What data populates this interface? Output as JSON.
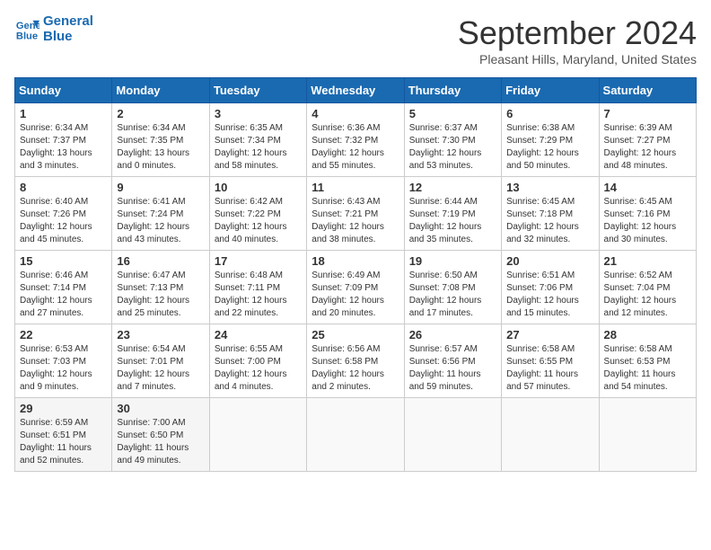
{
  "logo": {
    "line1": "General",
    "line2": "Blue"
  },
  "title": "September 2024",
  "subtitle": "Pleasant Hills, Maryland, United States",
  "days_of_week": [
    "Sunday",
    "Monday",
    "Tuesday",
    "Wednesday",
    "Thursday",
    "Friday",
    "Saturday"
  ],
  "weeks": [
    [
      {
        "day": "1",
        "sunrise": "6:34 AM",
        "sunset": "7:37 PM",
        "daylight": "13 hours and 3 minutes."
      },
      {
        "day": "2",
        "sunrise": "6:34 AM",
        "sunset": "7:35 PM",
        "daylight": "13 hours and 0 minutes."
      },
      {
        "day": "3",
        "sunrise": "6:35 AM",
        "sunset": "7:34 PM",
        "daylight": "12 hours and 58 minutes."
      },
      {
        "day": "4",
        "sunrise": "6:36 AM",
        "sunset": "7:32 PM",
        "daylight": "12 hours and 55 minutes."
      },
      {
        "day": "5",
        "sunrise": "6:37 AM",
        "sunset": "7:30 PM",
        "daylight": "12 hours and 53 minutes."
      },
      {
        "day": "6",
        "sunrise": "6:38 AM",
        "sunset": "7:29 PM",
        "daylight": "12 hours and 50 minutes."
      },
      {
        "day": "7",
        "sunrise": "6:39 AM",
        "sunset": "7:27 PM",
        "daylight": "12 hours and 48 minutes."
      }
    ],
    [
      {
        "day": "8",
        "sunrise": "6:40 AM",
        "sunset": "7:26 PM",
        "daylight": "12 hours and 45 minutes."
      },
      {
        "day": "9",
        "sunrise": "6:41 AM",
        "sunset": "7:24 PM",
        "daylight": "12 hours and 43 minutes."
      },
      {
        "day": "10",
        "sunrise": "6:42 AM",
        "sunset": "7:22 PM",
        "daylight": "12 hours and 40 minutes."
      },
      {
        "day": "11",
        "sunrise": "6:43 AM",
        "sunset": "7:21 PM",
        "daylight": "12 hours and 38 minutes."
      },
      {
        "day": "12",
        "sunrise": "6:44 AM",
        "sunset": "7:19 PM",
        "daylight": "12 hours and 35 minutes."
      },
      {
        "day": "13",
        "sunrise": "6:45 AM",
        "sunset": "7:18 PM",
        "daylight": "12 hours and 32 minutes."
      },
      {
        "day": "14",
        "sunrise": "6:45 AM",
        "sunset": "7:16 PM",
        "daylight": "12 hours and 30 minutes."
      }
    ],
    [
      {
        "day": "15",
        "sunrise": "6:46 AM",
        "sunset": "7:14 PM",
        "daylight": "12 hours and 27 minutes."
      },
      {
        "day": "16",
        "sunrise": "6:47 AM",
        "sunset": "7:13 PM",
        "daylight": "12 hours and 25 minutes."
      },
      {
        "day": "17",
        "sunrise": "6:48 AM",
        "sunset": "7:11 PM",
        "daylight": "12 hours and 22 minutes."
      },
      {
        "day": "18",
        "sunrise": "6:49 AM",
        "sunset": "7:09 PM",
        "daylight": "12 hours and 20 minutes."
      },
      {
        "day": "19",
        "sunrise": "6:50 AM",
        "sunset": "7:08 PM",
        "daylight": "12 hours and 17 minutes."
      },
      {
        "day": "20",
        "sunrise": "6:51 AM",
        "sunset": "7:06 PM",
        "daylight": "12 hours and 15 minutes."
      },
      {
        "day": "21",
        "sunrise": "6:52 AM",
        "sunset": "7:04 PM",
        "daylight": "12 hours and 12 minutes."
      }
    ],
    [
      {
        "day": "22",
        "sunrise": "6:53 AM",
        "sunset": "7:03 PM",
        "daylight": "12 hours and 9 minutes."
      },
      {
        "day": "23",
        "sunrise": "6:54 AM",
        "sunset": "7:01 PM",
        "daylight": "12 hours and 7 minutes."
      },
      {
        "day": "24",
        "sunrise": "6:55 AM",
        "sunset": "7:00 PM",
        "daylight": "12 hours and 4 minutes."
      },
      {
        "day": "25",
        "sunrise": "6:56 AM",
        "sunset": "6:58 PM",
        "daylight": "12 hours and 2 minutes."
      },
      {
        "day": "26",
        "sunrise": "6:57 AM",
        "sunset": "6:56 PM",
        "daylight": "11 hours and 59 minutes."
      },
      {
        "day": "27",
        "sunrise": "6:58 AM",
        "sunset": "6:55 PM",
        "daylight": "11 hours and 57 minutes."
      },
      {
        "day": "28",
        "sunrise": "6:58 AM",
        "sunset": "6:53 PM",
        "daylight": "11 hours and 54 minutes."
      }
    ],
    [
      {
        "day": "29",
        "sunrise": "6:59 AM",
        "sunset": "6:51 PM",
        "daylight": "11 hours and 52 minutes."
      },
      {
        "day": "30",
        "sunrise": "7:00 AM",
        "sunset": "6:50 PM",
        "daylight": "11 hours and 49 minutes."
      },
      null,
      null,
      null,
      null,
      null
    ]
  ]
}
